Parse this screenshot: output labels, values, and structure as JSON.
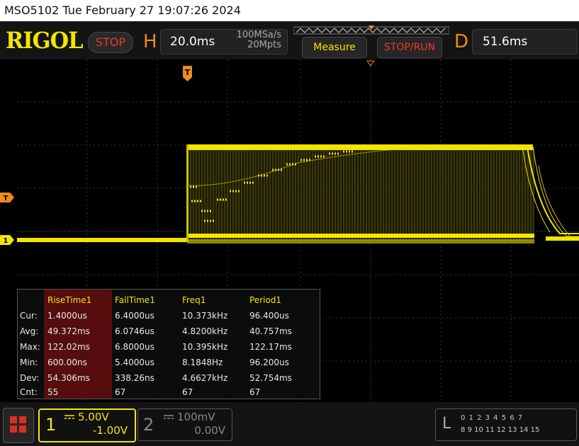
{
  "status_line": "MSO5102  Tue February 27 19:07:26 2024",
  "toolbar": {
    "logo": "RIGOL",
    "stop_label": "STOP",
    "horizontal_letter": "H",
    "timebase": "20.0ms",
    "sample_rate": "100MSa/s",
    "memory_depth": "20Mpts",
    "measure_label": "Measure",
    "stop_run_label": "STOP/RUN",
    "delay_letter": "D",
    "delay_value": "51.6ms"
  },
  "markers": {
    "trigger_top": "T",
    "trigger_level": "T",
    "channel1": "1"
  },
  "measurements": {
    "row_labels": [
      "Cur:",
      "Avg:",
      "Max:",
      "Min:",
      "Dev:",
      "Cnt:"
    ],
    "columns": [
      {
        "header": "RiseTime1",
        "values": [
          "1.4000us",
          "49.372ms",
          "122.02ms",
          "600.00ns",
          "54.306ms",
          "55"
        ]
      },
      {
        "header": "FallTime1",
        "values": [
          "6.4000us",
          "6.0746us",
          "6.8000us",
          "5.4000us",
          "338.26ns",
          "67"
        ]
      },
      {
        "header": "Freq1",
        "values": [
          "10.373kHz",
          "4.8200kHz",
          "10.395kHz",
          "8.1848Hz",
          "4.6627kHz",
          "67"
        ]
      },
      {
        "header": "Period1",
        "values": [
          "96.400us",
          "40.757ms",
          "122.17ms",
          "96.200us",
          "52.754ms",
          "67"
        ]
      }
    ]
  },
  "channels": {
    "ch1": {
      "number": "1",
      "scale": "5.00V",
      "offset": "-1.00V"
    },
    "ch2": {
      "number": "2",
      "scale": "100mV",
      "offset": "0.00V"
    }
  },
  "logic": {
    "letter": "L",
    "row1": "0 1 2 3  4 5 6 7",
    "row2": "8 9 10 11 12 13 14 15"
  },
  "colors": {
    "ch1": "#f2e600",
    "trigger": "#f08a1a",
    "stop": "#e83a2a"
  }
}
